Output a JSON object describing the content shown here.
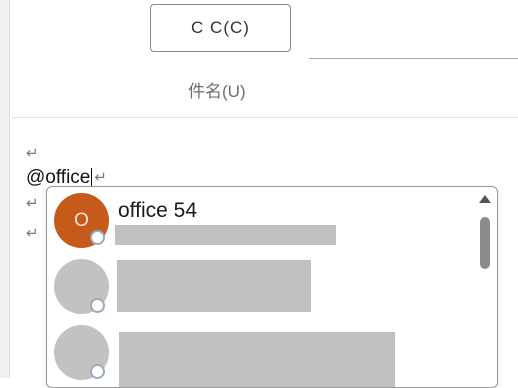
{
  "header": {
    "cc_button_label": "C C(C)",
    "subject_label": "件名(U)"
  },
  "body": {
    "paragraph_mark": "↵",
    "typed_text": "@office"
  },
  "suggestions": {
    "items": [
      {
        "name": "office 54",
        "initial": "O",
        "avatar_color": "#c55a1b"
      },
      {
        "name": "",
        "initial": "",
        "avatar_color": "#c2c2c2"
      },
      {
        "name": "",
        "initial": "",
        "avatar_color": "#c2c2c2"
      }
    ]
  },
  "colors": {
    "presence_ring": "#97aabf",
    "redaction": "#c0c0c0"
  }
}
